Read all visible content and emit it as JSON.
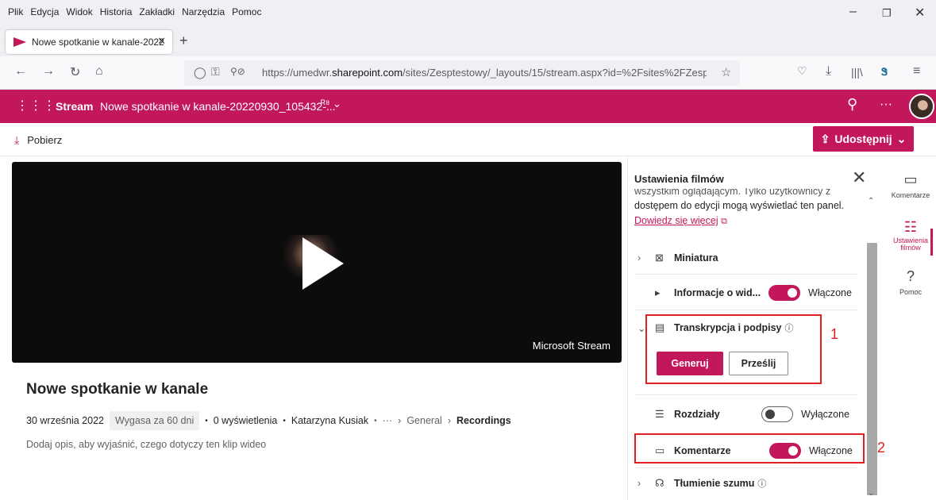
{
  "browser": {
    "menu": [
      "Plik",
      "Edycja",
      "Widok",
      "Historia",
      "Zakładki",
      "Narzędzia",
      "Pomoc"
    ],
    "tab_title": "Nowe spotkanie w kanale-2022",
    "url_prefix": "https://umedwr.",
    "url_domain": "sharepoint.com",
    "url_rest": "/sites/Zesptestowy/_layouts/15/stream.aspx?id=%2Fsites%2FZesptesto"
  },
  "app": {
    "brand": "Stream",
    "header_title": "Nowe spotkanie w kanale-20220930_105432-...",
    "download_label": "Pobierz",
    "share_label": "Udostępnij"
  },
  "video": {
    "watermark": "Microsoft Stream",
    "title": "Nowe spotkanie w kanale",
    "date": "30 września 2022",
    "expires": "Wygasa za 60 dni",
    "views": "0 wyświetlenia",
    "author": "Katarzyna Kusiak",
    "ellipsis": "···",
    "crumb1": "General",
    "crumb2": "Recordings",
    "description": "Dodaj opis, aby wyjaśnić, czego dotyczy ten klip wideo"
  },
  "panel": {
    "title": "Ustawienia filmów",
    "note_cut": "wszystkim oglądającym. Tylko użytkownicy z",
    "note": "dostępem do edycji mogą wyświetlać ten panel.",
    "learn_more": "Dowiedz się więcej",
    "thumbnail": "Miniatura",
    "viewer_info": "Informacje o wid...",
    "viewer_info_state": "Włączone",
    "transcript": "Transkrypcja i podpisy",
    "generate": "Generuj",
    "upload": "Prześlij",
    "chapters": "Rozdziały",
    "chapters_state": "Wyłączone",
    "comments": "Komentarze",
    "comments_state": "Włączone",
    "noise": "Tłumienie szumu"
  },
  "rail": {
    "comments": "Komentarze",
    "settings": "Ustawienia filmów",
    "help": "Pomoc"
  },
  "annotations": {
    "one": "1",
    "two": "2"
  },
  "colors": {
    "accent": "#c2185b",
    "annotation": "#e02020"
  }
}
